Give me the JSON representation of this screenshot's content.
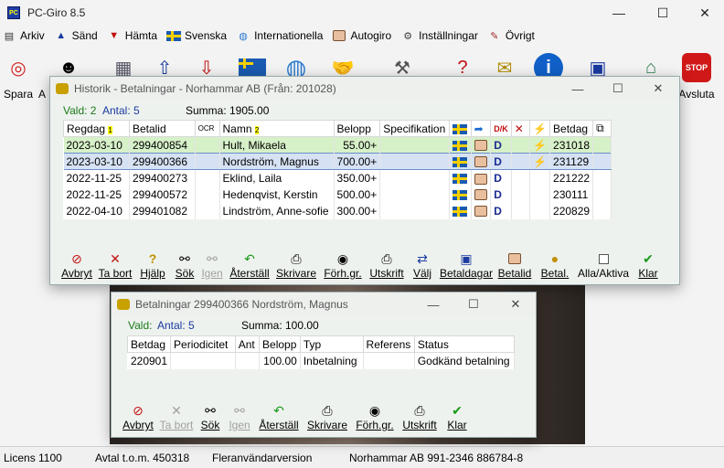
{
  "app": {
    "title": "PC-Giro 8.5",
    "icon_label": "PC"
  },
  "window_controls": {
    "minimize": "—",
    "maximize": "☐",
    "close": "✕"
  },
  "menu": [
    {
      "label": "Arkiv",
      "icon": "folder-icon"
    },
    {
      "label": "Sänd",
      "icon": "arrow-up-icon"
    },
    {
      "label": "Hämta",
      "icon": "arrow-down-icon"
    },
    {
      "label": "Svenska",
      "icon": "swedish-flag-icon"
    },
    {
      "label": "Internationella",
      "icon": "globe-icon"
    },
    {
      "label": "Autogiro",
      "icon": "handshake-icon"
    },
    {
      "label": "Inställningar",
      "icon": "gear-icon"
    },
    {
      "label": "Övrigt",
      "icon": "tools-icon"
    }
  ],
  "toolbar": {
    "spara": "Spara",
    "a": "A",
    "avsluta": "Avsluta"
  },
  "historik": {
    "title": "Historik - Betalningar - Norhammar AB (Från: 201028)",
    "vald": "Vald: 2",
    "antal": "Antal: 5",
    "summa": "Summa: 1905.00",
    "headers": {
      "regdag": "Regdag",
      "regdag_mark": "1",
      "betalid": "Betalid",
      "ocr": "OCR",
      "namn": "Namn",
      "namn_mark": "2",
      "belopp": "Belopp",
      "spec": "Specifikation",
      "dk": "D/K",
      "betdag": "Betdag"
    },
    "rows": [
      {
        "regdag": "2023-03-10",
        "betalid": "299400854",
        "namn": "Hult, Mikaela",
        "belopp": "55.00+",
        "dk": "D",
        "bolt": "⚡",
        "betdag": "231018"
      },
      {
        "regdag": "2023-03-10",
        "betalid": "299400366",
        "namn": "Nordström, Magnus",
        "belopp": "700.00+",
        "dk": "D",
        "bolt": "⚡",
        "betdag": "231129"
      },
      {
        "regdag": "2022-11-25",
        "betalid": "299400273",
        "namn": "Eklind, Laila",
        "belopp": "350.00+",
        "dk": "D",
        "bolt": "",
        "betdag": "221222"
      },
      {
        "regdag": "2022-11-25",
        "betalid": "299400572",
        "namn": "Hedenqvist, Kerstin",
        "belopp": "500.00+",
        "dk": "D",
        "bolt": "",
        "betdag": "230111"
      },
      {
        "regdag": "2022-04-10",
        "betalid": "299401082",
        "namn": "Lindström, Anne-sofie",
        "belopp": "300.00+",
        "dk": "D",
        "bolt": "",
        "betdag": "220829"
      }
    ],
    "actions": [
      "Avbryt",
      "Ta bort",
      "Hjälp",
      "Sök",
      "Igen",
      "Återställ",
      "Skrivare",
      "Förh.gr.",
      "Utskrift",
      "Välj",
      "Betaldagar",
      "Betalid",
      "Betal.",
      "Alla/Aktiva",
      "Klar"
    ]
  },
  "betalningar": {
    "title": "Betalningar  299400366 Nordström, Magnus",
    "vald": "Vald:",
    "antal": "Antal: 5",
    "summa": "Summa: 100.00",
    "headers": {
      "betdag": "Betdag",
      "periodicitet": "Periodicitet",
      "ant": "Ant",
      "belopp": "Belopp",
      "typ": "Typ",
      "referens": "Referens",
      "status": "Status"
    },
    "rows": [
      {
        "betdag": "220901",
        "periodicitet": "",
        "ant": "",
        "belopp": "100.00",
        "typ": "Inbetalning",
        "referens": "",
        "status": "Godkänd betalning"
      }
    ],
    "actions": [
      "Avbryt",
      "Ta bort",
      "Sök",
      "Igen",
      "Återställ",
      "Skrivare",
      "Förh.gr.",
      "Utskrift",
      "Klar"
    ]
  },
  "status": {
    "licens": "Licens 1100",
    "avtal": "Avtal t.o.m. 450318",
    "version": "Fleranvändarversion",
    "company": "Norhammar AB 991-2346 886784-8"
  }
}
